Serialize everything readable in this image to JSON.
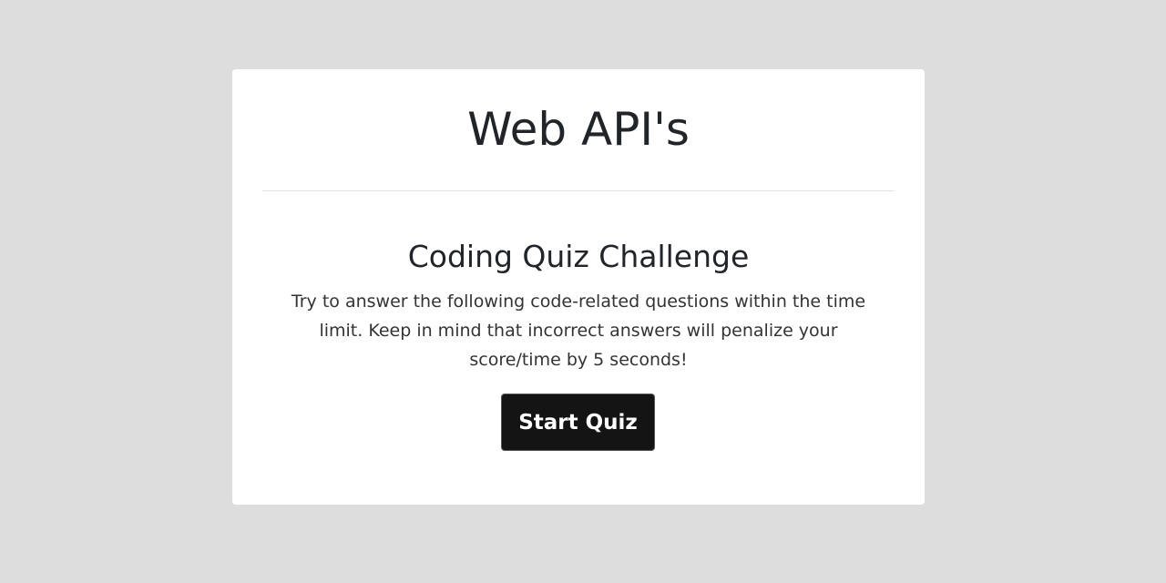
{
  "header": {
    "title": "Web API's"
  },
  "intro": {
    "heading": "Coding Quiz Challenge",
    "description": "Try to answer the following code-related questions within the time limit. Keep in mind that incorrect answers will penalize your score/time by 5 seconds!",
    "start_label": "Start Quiz"
  },
  "colors": {
    "background": "#dddddd",
    "card": "#ffffff",
    "button": "#141414"
  }
}
